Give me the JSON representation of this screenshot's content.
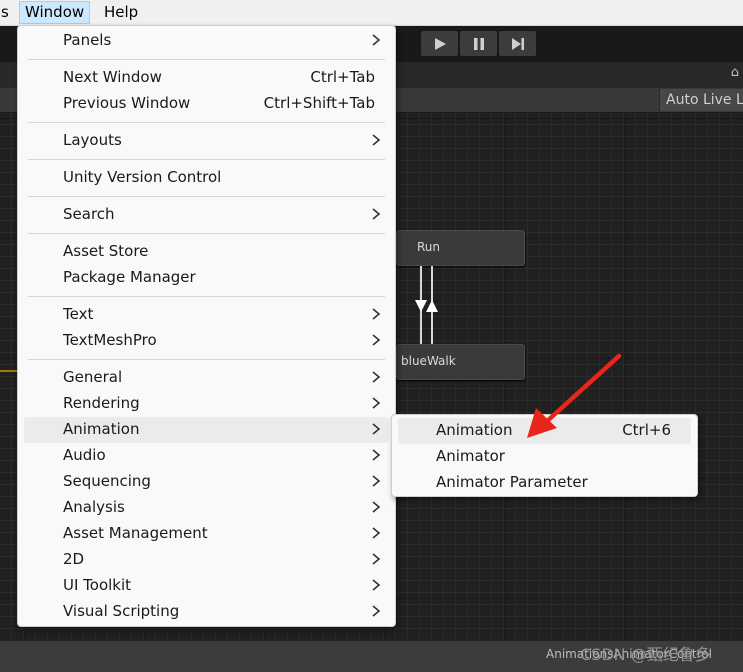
{
  "menubar": {
    "items": [
      {
        "label": "s"
      },
      {
        "label": "Window"
      },
      {
        "label": "Help"
      }
    ]
  },
  "graph": {
    "nodes": [
      {
        "label": "Run"
      },
      {
        "label": "blueWalk"
      }
    ]
  },
  "toolbar": {
    "auto_live_label": "Auto Live L"
  },
  "statusbar": {
    "path": "AnimationsAnimatorControl",
    "watermark": "CSDN @甄纪鲁多"
  },
  "window_menu": {
    "items": [
      {
        "label": "Panels",
        "shortcut": "",
        "submenu": true
      },
      {
        "label": "Next Window",
        "shortcut": "Ctrl+Tab",
        "submenu": false
      },
      {
        "label": "Previous Window",
        "shortcut": "Ctrl+Shift+Tab",
        "submenu": false
      },
      {
        "label": "Layouts",
        "shortcut": "",
        "submenu": true
      },
      {
        "label": "Unity Version Control",
        "shortcut": "",
        "submenu": false
      },
      {
        "label": "Search",
        "shortcut": "",
        "submenu": true
      },
      {
        "label": "Asset Store",
        "shortcut": "",
        "submenu": false
      },
      {
        "label": "Package Manager",
        "shortcut": "",
        "submenu": false
      },
      {
        "label": "Text",
        "shortcut": "",
        "submenu": true
      },
      {
        "label": "TextMeshPro",
        "shortcut": "",
        "submenu": true
      },
      {
        "label": "General",
        "shortcut": "",
        "submenu": true
      },
      {
        "label": "Rendering",
        "shortcut": "",
        "submenu": true
      },
      {
        "label": "Animation",
        "shortcut": "",
        "submenu": true,
        "highlighted": true
      },
      {
        "label": "Audio",
        "shortcut": "",
        "submenu": true
      },
      {
        "label": "Sequencing",
        "shortcut": "",
        "submenu": true
      },
      {
        "label": "Analysis",
        "shortcut": "",
        "submenu": true
      },
      {
        "label": "Asset Management",
        "shortcut": "",
        "submenu": true
      },
      {
        "label": "2D",
        "shortcut": "",
        "submenu": true
      },
      {
        "label": "UI Toolkit",
        "shortcut": "",
        "submenu": true
      },
      {
        "label": "Visual Scripting",
        "shortcut": "",
        "submenu": true
      }
    ]
  },
  "animation_submenu": {
    "items": [
      {
        "label": "Animation",
        "shortcut": "Ctrl+6",
        "highlighted": true
      },
      {
        "label": "Animator",
        "shortcut": ""
      },
      {
        "label": "Animator Parameter",
        "shortcut": ""
      }
    ]
  },
  "colors": {
    "menu_bg": "#f9f9f9",
    "menu_highlight": "#ebebeb",
    "annotation_arrow": "#e8261c",
    "editor_bg": "#202020"
  },
  "icons": [
    "play-icon",
    "pause-icon",
    "step-icon",
    "chevron-right-icon",
    "transition-arrow-down-icon",
    "transition-arrow-up-icon"
  ]
}
